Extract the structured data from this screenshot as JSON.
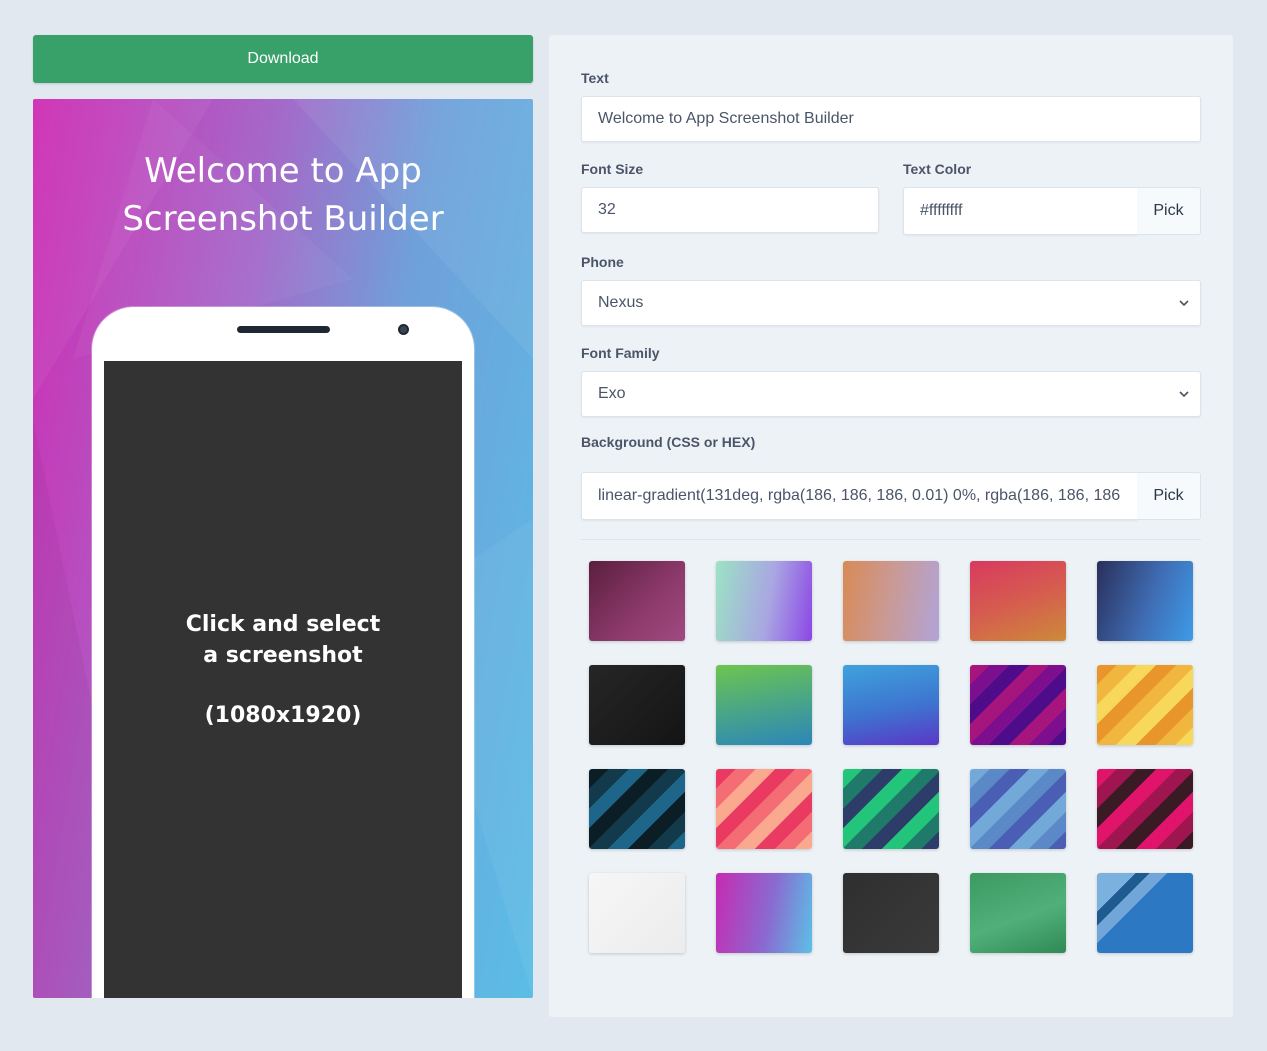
{
  "download": {
    "label": "Download",
    "color": "#38a169"
  },
  "preview": {
    "title": "Welcome to App Screenshot Builder",
    "text_color": "#ffffff",
    "screen_prompt_line1": "Click and select",
    "screen_prompt_line2": "a screenshot",
    "screen_resolution": "(1080x1920)"
  },
  "form": {
    "text_label": "Text",
    "text_value": "Welcome to App Screenshot Builder",
    "font_size_label": "Font Size",
    "font_size_value": "32",
    "text_color_label": "Text Color",
    "text_color_value": "#ffffffff",
    "pick_label": "Pick",
    "phone_label": "Phone",
    "phone_value": "Nexus",
    "font_family_label": "Font Family",
    "font_family_value": "Exo",
    "background_label": "Background (CSS or HEX)",
    "background_value": "linear-gradient(131deg, rgba(186, 186, 186, 0.01) 0%, rgba(186, 186, 186"
  },
  "swatches": [
    {
      "name": "plum",
      "bg": "linear-gradient(135deg,#5b1f3e,#8d3a6c 60%,#a04a82)"
    },
    {
      "name": "mint-violet",
      "bg": "linear-gradient(100deg,#9be3c4,#a9a6e2 55%,#8c46e6)"
    },
    {
      "name": "peach-lavender",
      "bg": "linear-gradient(100deg,#d98a55,#c99a97 50%,#b1a4d8)"
    },
    {
      "name": "rose-amber",
      "bg": "linear-gradient(160deg,#d8395f,#d65c4f 50%,#cd8a3a)"
    },
    {
      "name": "navy-sky",
      "bg": "linear-gradient(110deg,#2a2f5a,#3f6db4 55%,#3e9be8)"
    },
    {
      "name": "charcoal",
      "bg": "linear-gradient(135deg,#262626,#141414)"
    },
    {
      "name": "green-teal",
      "bg": "linear-gradient(170deg,#6dc54e,#4aa686 50%,#2c86b8)"
    },
    {
      "name": "sky-indigo",
      "bg": "linear-gradient(170deg,#3fa2dc,#3e74d0 55%,#5a37c7)"
    },
    {
      "name": "magenta-purple",
      "bg": "repeating-linear-gradient(135deg,#a6147e 0 14px,#7c0f8e 14px 28px,#4e0b8a 28px 42px)"
    },
    {
      "name": "gold",
      "bg": "repeating-linear-gradient(135deg,#e8962c 0 14px,#f0b63e 14px 28px,#f7d85a 28px 42px)"
    },
    {
      "name": "dark-teal",
      "bg": "repeating-linear-gradient(135deg,#0b1e26 0 14px,#123a4a 14px 28px,#1d6689 28px 42px)"
    },
    {
      "name": "coral",
      "bg": "repeating-linear-gradient(135deg,#ea3a62 0 14px,#f46c74 14px 28px,#fba98e 28px 42px)"
    },
    {
      "name": "emerald-navy",
      "bg": "repeating-linear-gradient(135deg,#22c57a 0 14px,#1f7a6a 14px 28px,#2c3d6a 28px 42px)"
    },
    {
      "name": "steel-blue",
      "bg": "repeating-linear-gradient(135deg,#73a9d8 0 14px,#5b88c6 14px 28px,#4a5fb4 28px 42px)"
    },
    {
      "name": "crimson-dark",
      "bg": "repeating-linear-gradient(135deg,#e0146a 0 14px,#9e1550 14px 28px,#3a1a24 28px 42px)"
    },
    {
      "name": "white",
      "bg": "linear-gradient(135deg,#f6f6f6,#ececec)"
    },
    {
      "name": "magenta-sky",
      "bg": "linear-gradient(100deg,#c62bb2,#8a6ad0 55%,#5cc0e6)"
    },
    {
      "name": "graphite",
      "bg": "linear-gradient(135deg,#2f2f2f,#3a3a3a)"
    },
    {
      "name": "forest",
      "bg": "linear-gradient(160deg,#3a9a60,#51b07a 55%,#2f8a55)"
    },
    {
      "name": "ocean",
      "bg": "linear-gradient(135deg,#7ab1de 0 22%,#1f5a90 22% 30%,#73a6d8 30% 40%,#2d78c2 40%)"
    }
  ]
}
